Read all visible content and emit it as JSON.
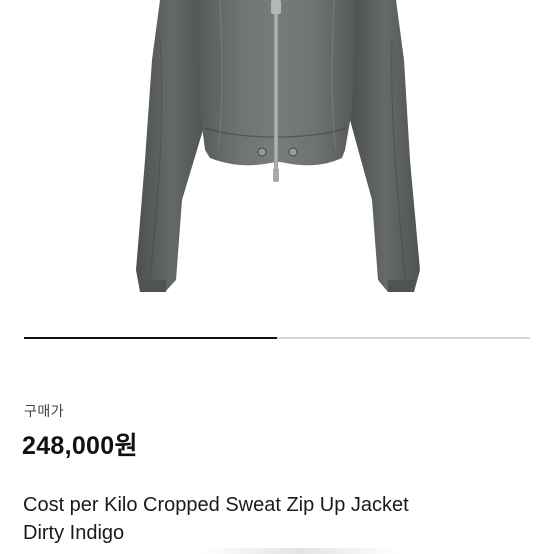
{
  "product": {
    "image_alt": "jacket-photo",
    "price_label": "구매가",
    "price": "248,000원",
    "title_line1": "Cost per Kilo Cropped Sweat Zip Up Jacket",
    "title_line2": "Dirty Indigo"
  },
  "gallery": {
    "progress": 0.5
  },
  "colors": {
    "jacket": "#5f6262",
    "jacket_dark": "#4a4d4e",
    "jacket_light": "#7e8180",
    "progress_fill": "#111111",
    "progress_track": "#d6d6d6"
  }
}
